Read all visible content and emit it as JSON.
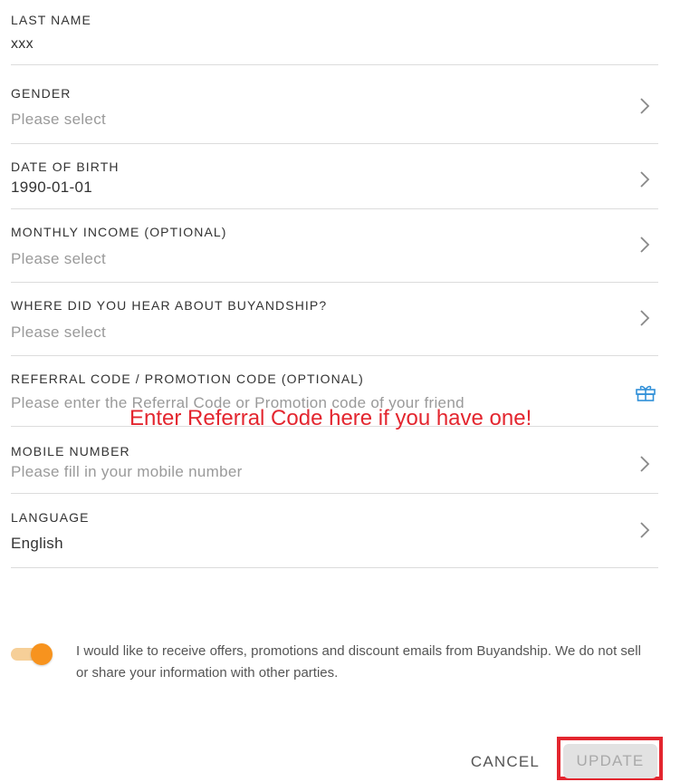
{
  "form": {
    "last_name": {
      "label": "LAST NAME",
      "value": "xxx"
    },
    "gender": {
      "label": "GENDER",
      "placeholder": "Please select"
    },
    "date_of_birth": {
      "label": "DATE OF BIRTH",
      "value": "1990-01-01"
    },
    "monthly_income": {
      "label": "MONTHLY INCOME (OPTIONAL)",
      "placeholder": "Please select"
    },
    "referral_source": {
      "label": "WHERE DID YOU HEAR ABOUT BUYANDSHIP?",
      "placeholder": "Please select"
    },
    "referral_code": {
      "label": "REFERRAL CODE / PROMOTION CODE (OPTIONAL)",
      "placeholder": "Please enter the Referral Code or Promotion code of your friend"
    },
    "mobile_number": {
      "label": "MOBILE NUMBER",
      "placeholder": "Please fill in your mobile number"
    },
    "language": {
      "label": "LANGUAGE",
      "value": "English"
    }
  },
  "annotation": {
    "text": "Enter Referral Code here if you have one!",
    "color": "#e3262f"
  },
  "consent": {
    "text": "I would like to receive offers, promotions and discount emails from Buyandship. We do not sell or share your information with other parties.",
    "toggle_on": true,
    "accent_color": "#f7931e"
  },
  "actions": {
    "cancel_label": "CANCEL",
    "update_label": "UPDATE"
  },
  "icons": {
    "chevron": "chevron-right-icon",
    "gift": "gift-icon"
  }
}
